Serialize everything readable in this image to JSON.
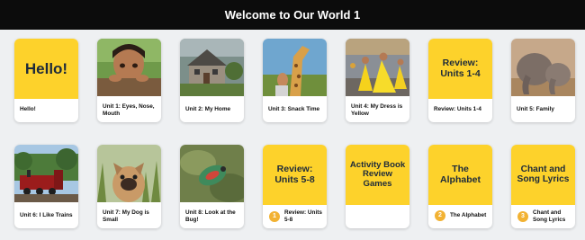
{
  "header": {
    "title": "Welcome to Our World 1"
  },
  "cards": [
    {
      "label": "Hello!",
      "yellow_text": "Hello!"
    },
    {
      "label": "Unit 1: Eyes, Nose, Mouth"
    },
    {
      "label": "Unit 2: My Home"
    },
    {
      "label": "Unit 3: Snack Time"
    },
    {
      "label": "Unit 4: My Dress is Yellow"
    },
    {
      "label": "Review: Units 1-4",
      "yellow_text": "Review: Units 1-4"
    },
    {
      "label": "Unit 5: Family"
    },
    {
      "label": "Unit 6: I Like Trains"
    },
    {
      "label": "Unit 7: My Dog is Small"
    },
    {
      "label": "Unit 8: Look at the Bug!"
    },
    {
      "label": "Review: Units 5-8",
      "yellow_text": "Review: Units 5-8",
      "badge": "1"
    },
    {
      "label": "",
      "yellow_text": "Activity Book Review Games"
    },
    {
      "label": "The Alphabet",
      "yellow_text": "The Alphabet",
      "badge": "2"
    },
    {
      "label": "Chant and Song Lyrics",
      "yellow_text": "Chant and Song Lyrics",
      "badge": "3"
    }
  ],
  "colors": {
    "header_bg": "#0c0c0c",
    "card_yellow": "#fdd22b",
    "badge": "#f2b233",
    "page_bg": "#eef0f2"
  }
}
